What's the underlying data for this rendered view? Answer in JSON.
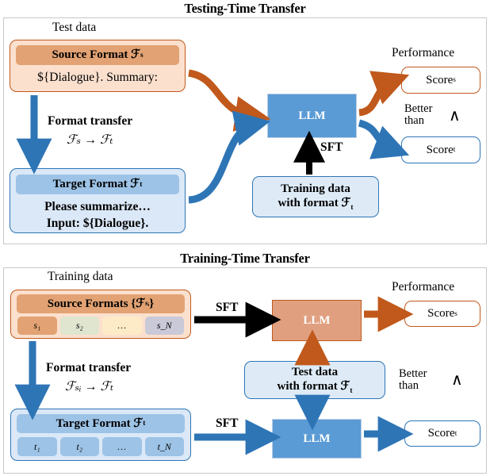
{
  "panels": {
    "top": {
      "title": "Testing-Time Transfer",
      "data_label": "Test data",
      "source_card": {
        "header": "Source Format ℱ",
        "header_sub": "s",
        "body": "${Dialogue}. Summary:"
      },
      "transfer_label": "Format transfer",
      "transfer_formula": "ℱₛ → ℱₜ",
      "target_card": {
        "header": "Target Format ℱ",
        "header_sub": "t",
        "body_line1": "Please summarize…",
        "body_line2": "Input: ${Dialogue}."
      },
      "llm": "LLM",
      "sft": "SFT",
      "training_box_line1": "Training data",
      "training_box_line2": "with format ℱ",
      "training_box_sub": "t",
      "performance": "Performance",
      "score_s": "Score",
      "score_s_sub": "s",
      "score_t": "Score",
      "score_t_sub": "t",
      "better_line1": "Better",
      "better_line2": "than",
      "caret": "∧"
    },
    "bottom": {
      "title": "Training-Time Transfer",
      "data_label": "Training data",
      "source_card": {
        "header": "Source Formats {ℱ",
        "header_sub": "sᵢ",
        "header_tail": "}"
      },
      "source_cells": [
        "s₁",
        "s₂",
        "…",
        "s_N"
      ],
      "transfer_label": "Format transfer",
      "transfer_formula": "ℱₛᵢ → ℱₜ",
      "target_card": {
        "header": "Target Format ℱ",
        "header_sub": "t"
      },
      "target_cells": [
        "t₁",
        "t₂",
        "…",
        "t_N"
      ],
      "sft_top": "SFT",
      "sft_bottom": "SFT",
      "llm_orange": "LLM",
      "llm_blue": "LLM",
      "test_box_line1": "Test data",
      "test_box_line2": "with format  ℱ",
      "test_box_sub": "t",
      "performance": "Performance",
      "score_s": "Score",
      "score_s_sub": "s",
      "score_t": "Score",
      "score_t_sub": "t",
      "better_line1": "Better",
      "better_line2": "than",
      "caret": "∧"
    }
  },
  "colors": {
    "orange_border": "#C0591B",
    "orange_fill": "#E2A273",
    "orange_light": "#fbe0ce",
    "blue_border": "#2E75B6",
    "blue_fill": "#5B9BD5",
    "blue_light": "#dbe8f7",
    "cell_green": "#dfe5cf",
    "cell_cream": "#fdebc8",
    "cell_grey": "#c9c9d8"
  }
}
